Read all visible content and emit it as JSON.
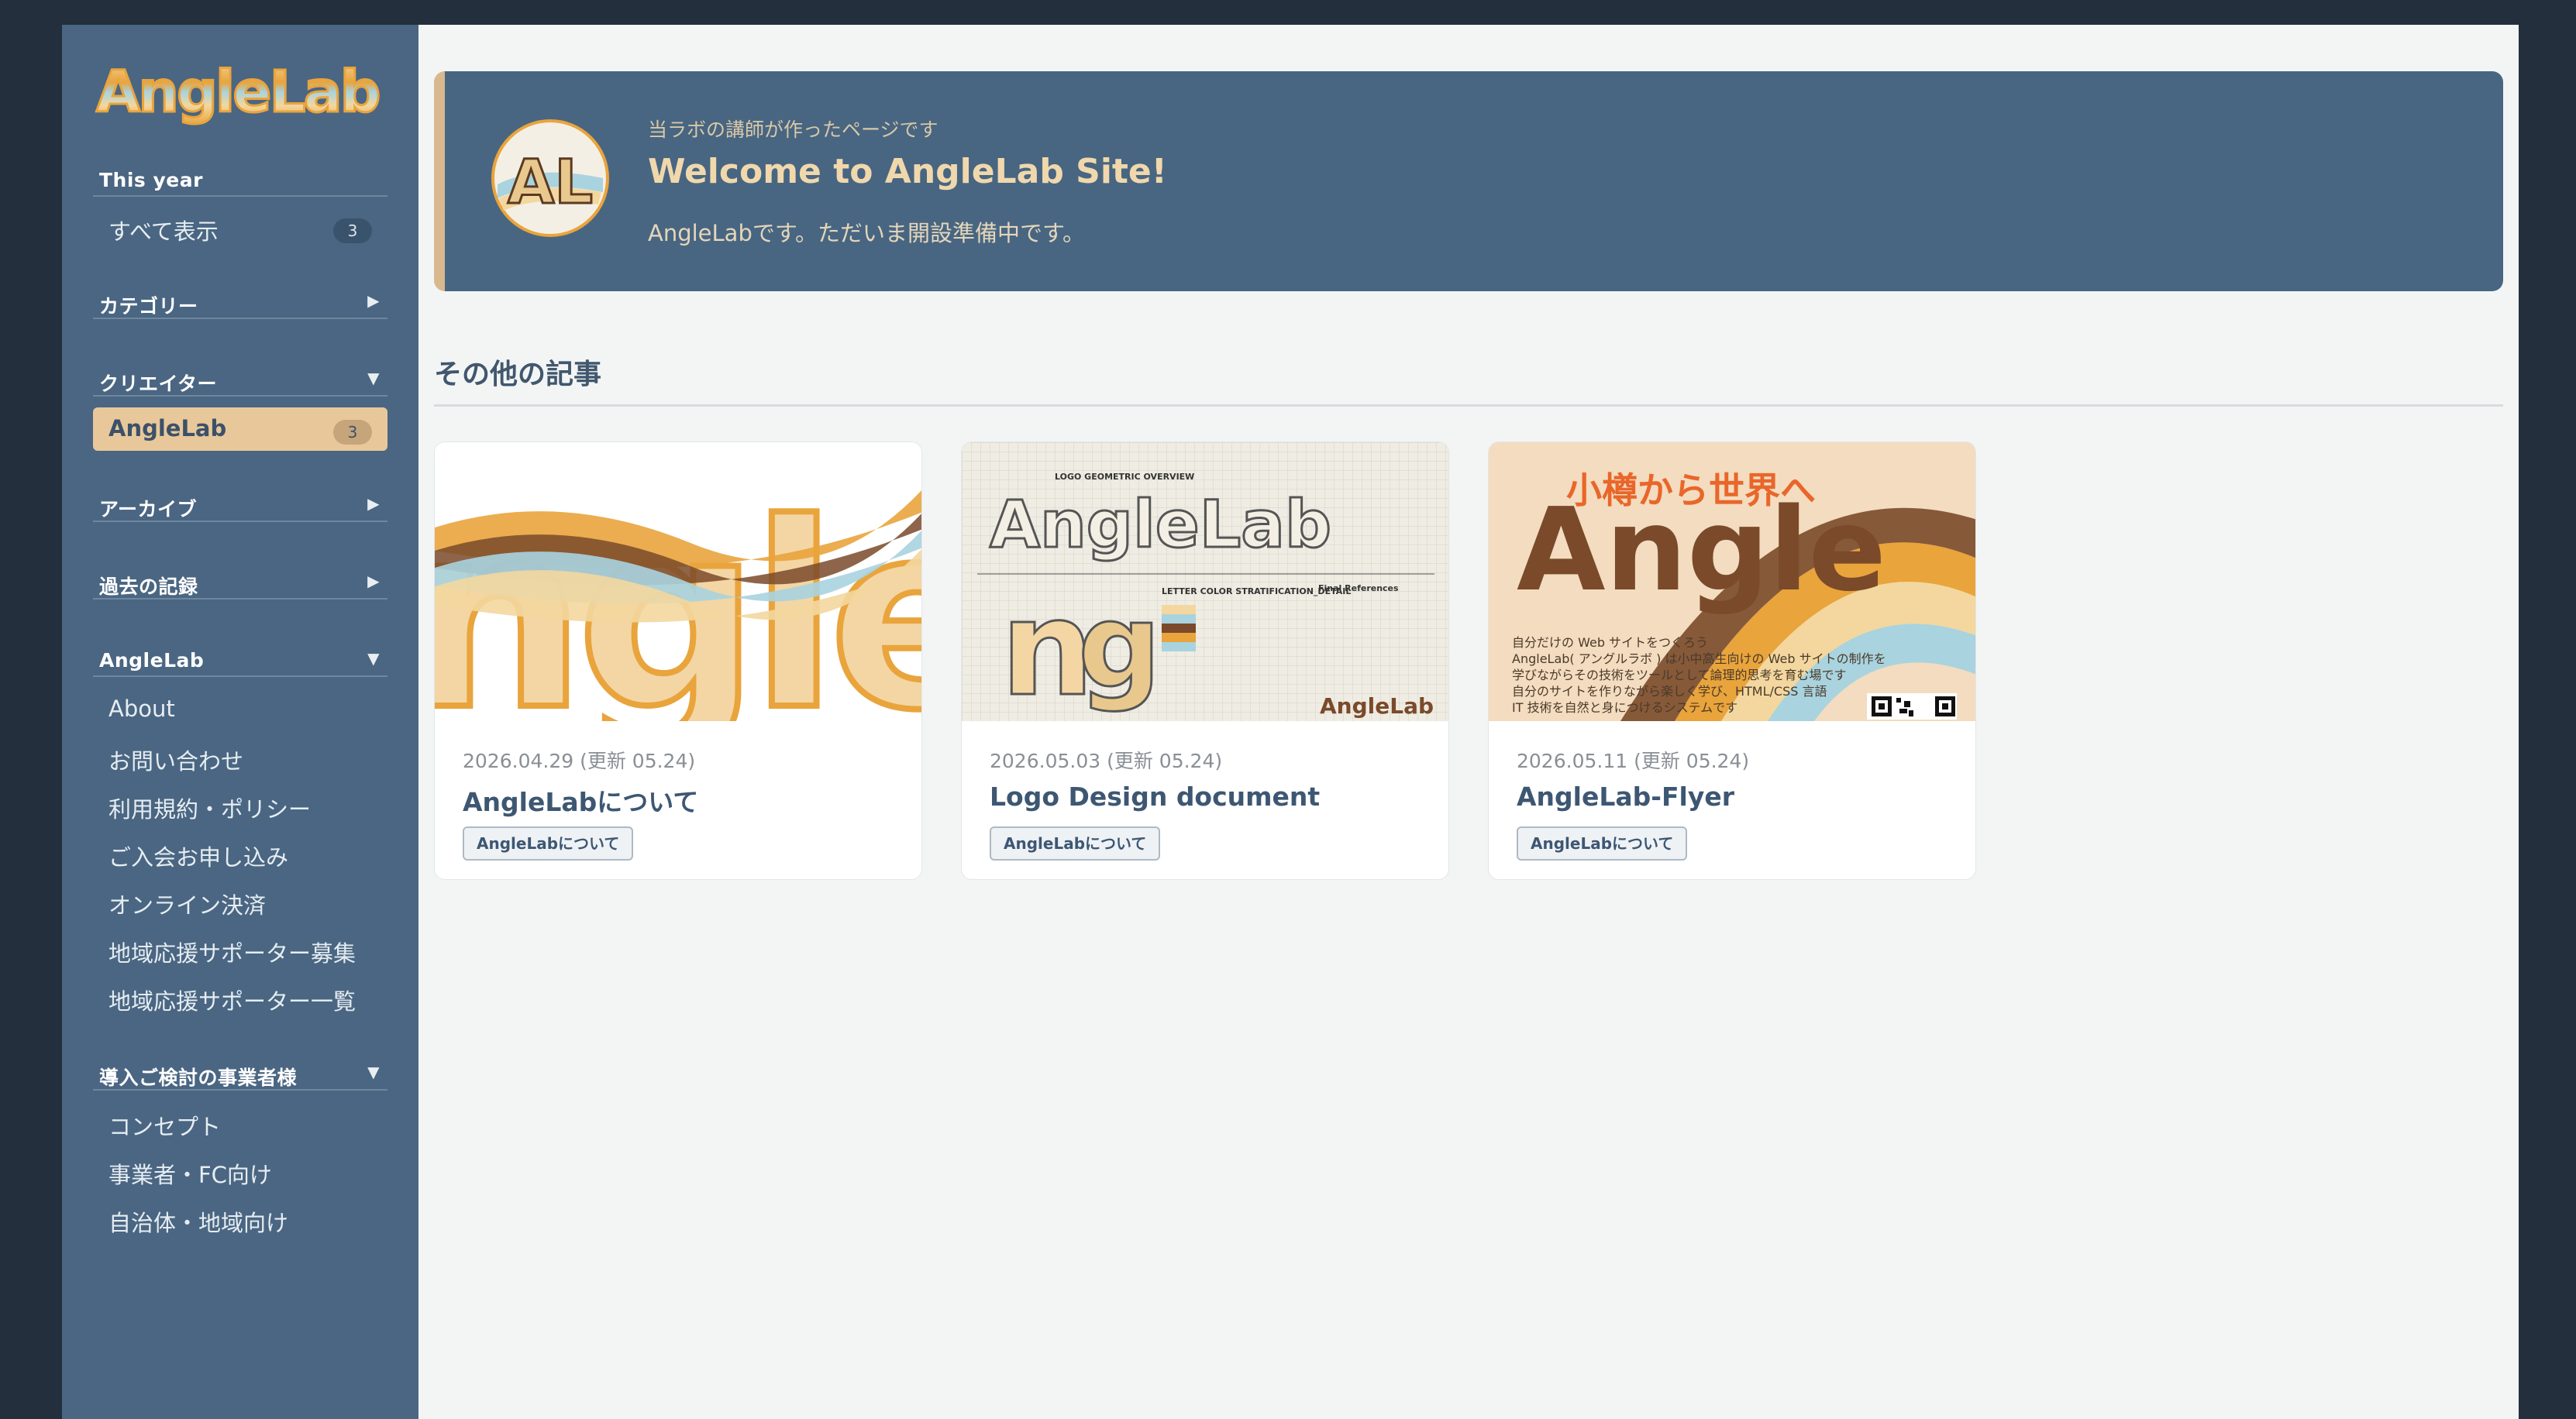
{
  "sidebar": {
    "logo_text": "AngleLab",
    "this_year": {
      "label": "This year",
      "items": [
        {
          "label": "すべて表示",
          "count": "3"
        }
      ]
    },
    "categories": {
      "label": "カテゴリー",
      "arrow": "▶"
    },
    "creators": {
      "label": "クリエイター",
      "arrow": "▼",
      "items": [
        {
          "label": "AngleLab",
          "count": "3"
        }
      ]
    },
    "archive": {
      "label": "アーカイブ",
      "arrow": "▶"
    },
    "past": {
      "label": "過去の記録",
      "arrow": "▶"
    },
    "anglelab": {
      "label": "AngleLab",
      "arrow": "▼",
      "items": [
        {
          "label": "About"
        },
        {
          "label": "お問い合わせ"
        },
        {
          "label": "利用規約・ポリシー"
        },
        {
          "label": "ご入会お申し込み"
        },
        {
          "label": "オンライン決済"
        },
        {
          "label": "地域応援サポーター募集"
        },
        {
          "label": "地域応援サポーター一覧"
        }
      ]
    },
    "business": {
      "label": "導入ご検討の事業者様",
      "arrow": "▼",
      "items": [
        {
          "label": "コンセプト"
        },
        {
          "label": "事業者・FC向け"
        },
        {
          "label": "自治体・地域向け"
        }
      ]
    }
  },
  "hero": {
    "avatar_text": "AL",
    "kicker": "当ラボの講師が作ったページです",
    "title": "Welcome to AngleLab Site!",
    "subtitle": "AngleLabです。ただいま開設準備中です。"
  },
  "main": {
    "section_title": "その他の記事",
    "cards": [
      {
        "date": "2026.04.29 (更新 05.24)",
        "title": "AngleLabについて",
        "tag": "AngleLabについて",
        "thumb_text": "ngleL"
      },
      {
        "date": "2026.05.03 (更新 05.24)",
        "title": "Logo Design document",
        "tag": "AngleLabについて",
        "thumb_labels": [
          "LOGO GEOMETRIC OVERVIEW",
          "AngleLab",
          "LETTER COLOR STRATIFICATION_DETAIL",
          "Final References",
          "AngleLab"
        ]
      },
      {
        "date": "2026.05.11 (更新 05.24)",
        "title": "AngleLab-Flyer",
        "tag": "AngleLabについて",
        "thumb_lines": [
          "小樽から世界へ",
          "Angle",
          "自分だけの Web サイトをつくろう",
          "AngleLab( アングルラボ ) は小中高生向けの Web サイトの制作を",
          "学びながらその技術をツールとして論理的思考を育む場です",
          "自分のサイトを作りながら楽しく学び、HTML/CSS 言語",
          "IT 技術を自然と身につけるシステムです"
        ]
      }
    ]
  },
  "colors": {
    "page_bg": "#232f3d",
    "sidebar": "#4a6682",
    "hero": "#486682",
    "accent_gold": "#e8c89a",
    "brown": "#7a4a2a",
    "orange": "#e9a43c",
    "teal": "#a9d3df"
  }
}
